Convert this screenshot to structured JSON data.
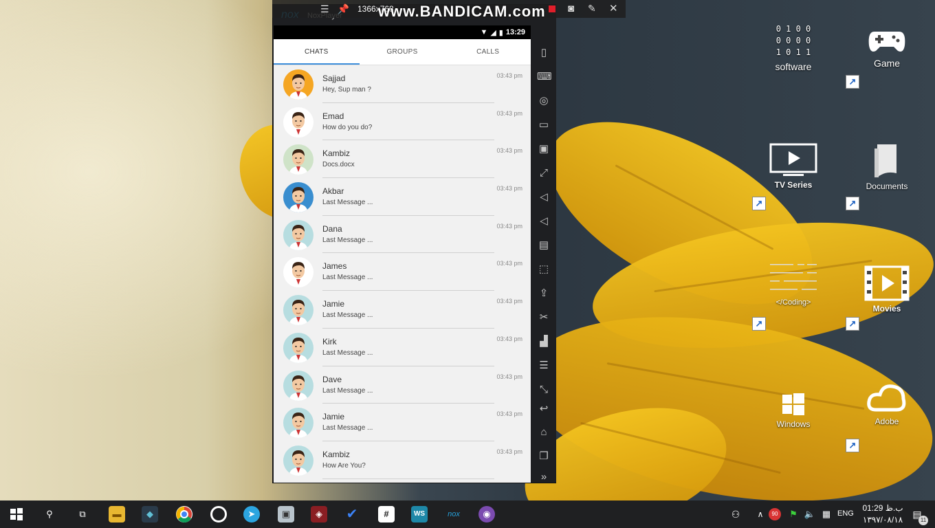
{
  "recorder": {
    "resolution": "1366x768",
    "watermark": "www.BANDICAM.com"
  },
  "emulator": {
    "logo": "nox",
    "title": "NoxPlayer"
  },
  "phone": {
    "status_time": "13:29",
    "tabs": [
      {
        "label": "CHATS",
        "active": true
      },
      {
        "label": "GROUPS",
        "active": false
      },
      {
        "label": "CALLS",
        "active": false
      }
    ],
    "chats": [
      {
        "name": "Sajjad",
        "message": "Hey, Sup man ?",
        "time": "03:43 pm",
        "avatar": "orange"
      },
      {
        "name": "Emad",
        "message": "How do you do?",
        "time": "03:43 pm",
        "avatar": "white"
      },
      {
        "name": "Kambiz",
        "message": "Docs.docx",
        "time": "03:43 pm",
        "avatar": "green"
      },
      {
        "name": "Akbar",
        "message": "Last Message ...",
        "time": "03:43 pm",
        "avatar": "blue"
      },
      {
        "name": "Dana",
        "message": "Last Message ...",
        "time": "03:43 pm",
        "avatar": "teal"
      },
      {
        "name": "James",
        "message": "Last Message ...",
        "time": "03:43 pm",
        "avatar": "white"
      },
      {
        "name": "Jamie",
        "message": "Last Message ...",
        "time": "03:43 pm",
        "avatar": "teal"
      },
      {
        "name": "Kirk",
        "message": "Last Message ...",
        "time": "03:43 pm",
        "avatar": "teal"
      },
      {
        "name": "Dave",
        "message": "Last Message ...",
        "time": "03:43 pm",
        "avatar": "teal"
      },
      {
        "name": "Jamie",
        "message": "Last Message ...",
        "time": "03:43 pm",
        "avatar": "teal"
      },
      {
        "name": "Kambiz",
        "message": "How Are You?",
        "time": "03:43 pm",
        "avatar": "teal"
      }
    ]
  },
  "desktop": {
    "icons": {
      "software": "software",
      "game": "Game",
      "tv_series": "TV Series",
      "documents": "Documents",
      "coding": "</Coding>",
      "movies": "Movies",
      "windows": "Windows",
      "adobe": "Adobe"
    },
    "software_bits": "0 1 0 0\n0 0 0 0\n1 0 1 1"
  },
  "taskbar": {
    "language": "ENG",
    "time": "01:29 ب.ظ",
    "date": "۱۳۹۷/۰۸/۱۸",
    "badge_count": "90",
    "notification_count": "11"
  },
  "colors": {
    "accent": "#3d8edb",
    "taskbar": "#1f2022",
    "emulator_chrome": "#1e1f22"
  }
}
